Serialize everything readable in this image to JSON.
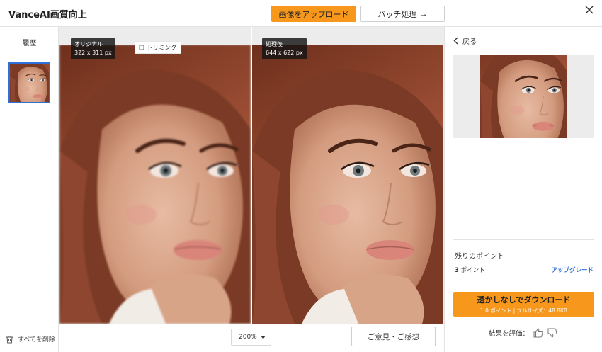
{
  "app": {
    "title": "VanceAI画質向上"
  },
  "header": {
    "upload_label": "画像をアップロード",
    "batch_label": "バッチ処理",
    "batch_arrow": "→",
    "close_icon": "close-icon"
  },
  "sidebar": {
    "history_label": "履歴",
    "delete_all_label": "すべてを削除"
  },
  "compare": {
    "original_label": "オリジナル",
    "original_size": "322 x 311 px",
    "trim_label": "トリミング",
    "processed_label": "処理後",
    "processed_size": "644 x 622 px"
  },
  "toolbar": {
    "zoom_value": "200%",
    "feedback_label": "ご意見・ご感想"
  },
  "panel": {
    "back_label": "戻る",
    "points_title": "残りのポイント",
    "points_count": "3",
    "points_unit": "ポイント",
    "upgrade_label": "アップグレード",
    "download_label": "透かしなしでダウンロード",
    "download_sub": "1.0 ポイント | フルサイズ：48.8KB",
    "rate_label": "結果を評価："
  },
  "colors": {
    "accent": "#f7981d",
    "link": "#2e6fd9",
    "canvas_bg": "#ececec"
  }
}
